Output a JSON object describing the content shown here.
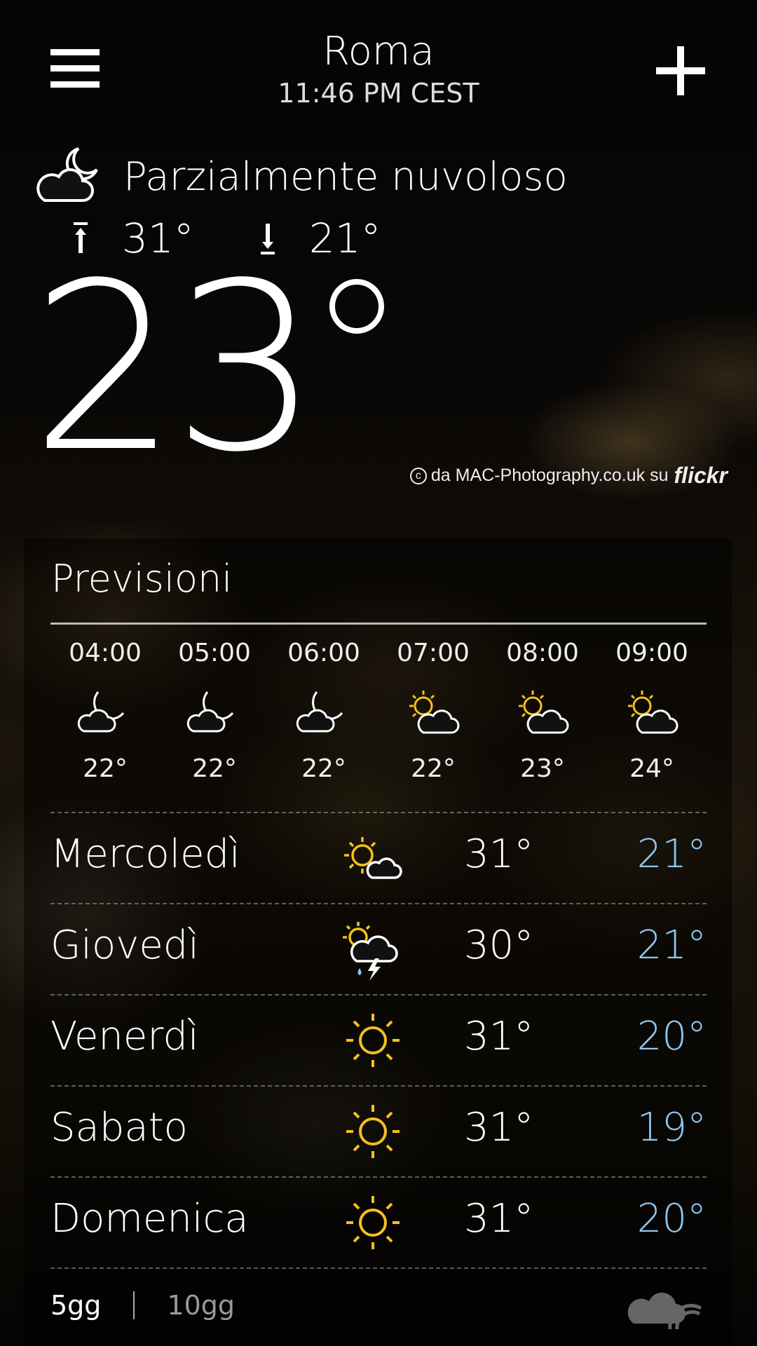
{
  "header": {
    "city": "Roma",
    "time": "11:46 PM CEST"
  },
  "current": {
    "condition": "Parzialmente nuvoloso",
    "condition_icon": "partly-cloudy-night-icon",
    "high": "31°",
    "low": "21°",
    "temperature": "23"
  },
  "credit": {
    "text": "da MAC-Photography.co.uk su",
    "brand": "flickr"
  },
  "forecast": {
    "title": "Previsioni",
    "hourly": [
      {
        "time": "04:00",
        "icon": "moon-cloud-icon",
        "temp": "22°"
      },
      {
        "time": "05:00",
        "icon": "moon-cloud-icon",
        "temp": "22°"
      },
      {
        "time": "06:00",
        "icon": "moon-cloud-icon",
        "temp": "22°"
      },
      {
        "time": "07:00",
        "icon": "sun-cloud-icon",
        "temp": "22°"
      },
      {
        "time": "08:00",
        "icon": "sun-cloud-icon",
        "temp": "23°"
      },
      {
        "time": "09:00",
        "icon": "sun-cloud-icon",
        "temp": "24°"
      }
    ],
    "daily": [
      {
        "day": "Mercoledì",
        "icon": "sun-cloud-icon",
        "high": "31°",
        "low": "21°"
      },
      {
        "day": "Giovedì",
        "icon": "thunderstorm-icon",
        "high": "30°",
        "low": "21°"
      },
      {
        "day": "Venerdì",
        "icon": "sun-icon",
        "high": "31°",
        "low": "20°"
      },
      {
        "day": "Sabato",
        "icon": "sun-icon",
        "high": "31°",
        "low": "19°"
      },
      {
        "day": "Domenica",
        "icon": "sun-icon",
        "high": "31°",
        "low": "20°"
      }
    ]
  },
  "range": {
    "option_5": "5gg",
    "option_10": "10gg",
    "selected": "5gg"
  },
  "colors": {
    "sun": "#f4c01f",
    "low_temp": "#8ec7f2",
    "text": "#ffffff"
  }
}
